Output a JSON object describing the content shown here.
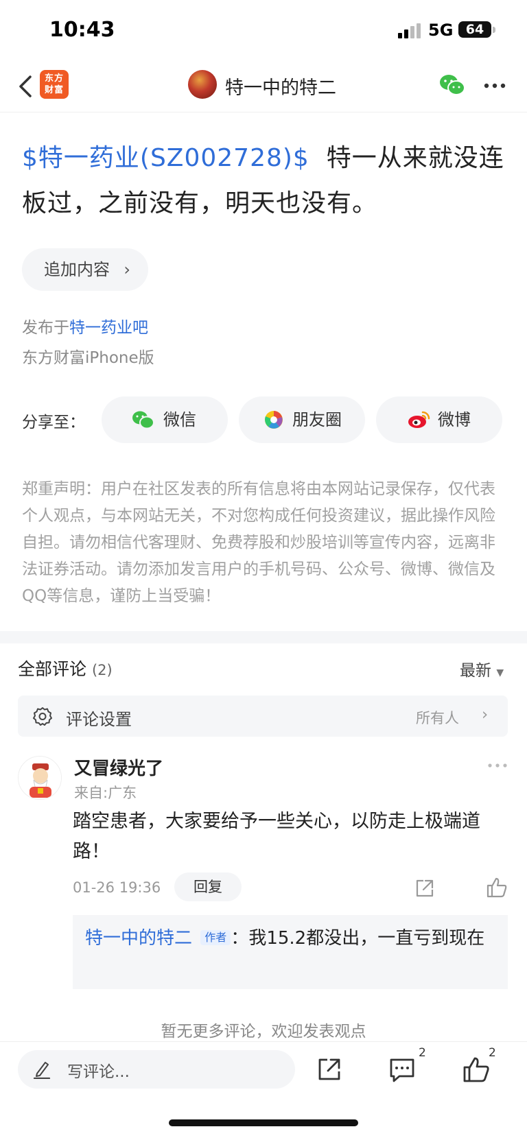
{
  "status_bar": {
    "time": "10:43",
    "network": "5G",
    "battery": "64"
  },
  "nav": {
    "logo_line1": "东方",
    "logo_line2": "财富",
    "title": "特一中的特二"
  },
  "post": {
    "stock_tag": "$特一药业(SZ002728)$",
    "text": "特一从来就没连板过，之前没有，明天也没有。",
    "append_label": "追加内容",
    "published_prefix": "发布于",
    "published_board": "特一药业吧",
    "client": "东方财富iPhone版"
  },
  "share": {
    "label": "分享至：",
    "targets": [
      {
        "label": "微信",
        "icon": "wechat-icon"
      },
      {
        "label": "朋友圈",
        "icon": "moments-icon"
      },
      {
        "label": "微博",
        "icon": "weibo-icon"
      }
    ]
  },
  "disclaimer": "郑重声明：用户在社区发表的所有信息将由本网站记录保存，仅代表个人观点，与本网站无关，不对您构成任何投资建议，据此操作风险自担。请勿相信代客理财、免费荐股和炒股培训等宣传内容，远离非法证券活动。请勿添加发言用户的手机号码、公众号、微博、微信及QQ等信息，谨防上当受骗！",
  "comments": {
    "title": "全部评论",
    "count": "(2)",
    "sort": "最新",
    "settings_label": "评论设置",
    "settings_value": "所有人",
    "items": [
      {
        "user": "又冒绿光了",
        "location": "来自:广东",
        "text": "踏空患者，大家要给予一些关心，以防走上极端道路！",
        "time": "01-26 19:36",
        "reply_label": "回复",
        "replies": [
          {
            "author": "特一中的特二",
            "tag": "作者",
            "separator": "：",
            "text": "我15.2都没出，一直亏到现在"
          }
        ]
      }
    ],
    "no_more": "暂无更多评论，欢迎发表观点"
  },
  "bottom_bar": {
    "input_placeholder": "写评论...",
    "comment_badge": "2",
    "like_badge": "2"
  },
  "colors": {
    "link": "#2f6dd8",
    "brand": "#f05a24",
    "wechat": "#3fbf4a",
    "weibo": "#e6162d"
  }
}
